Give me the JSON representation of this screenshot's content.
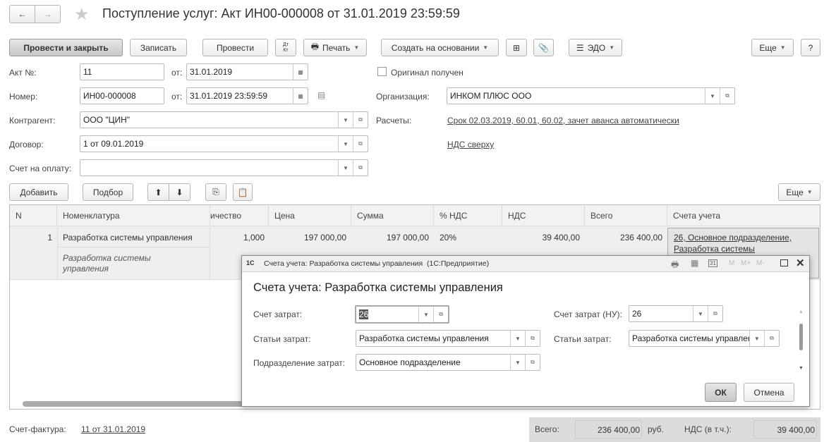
{
  "window": {
    "title": "Поступление услуг: Акт ИН00-000008 от 31.01.2019 23:59:59",
    "back": "←",
    "forward": "→",
    "star": "★"
  },
  "toolbar": {
    "post_close": "Провести и закрыть",
    "save": "Записать",
    "post": "Провести",
    "dtkt_top": "Дт",
    "dtkt_bottom": "Кт",
    "print": "Печать",
    "create_based": "Создать на основании",
    "edo": "ЭДО",
    "more": "Еще",
    "help": "?"
  },
  "form": {
    "act_no_label": "Акт №:",
    "act_no": "11",
    "from_label": "от:",
    "act_date": "31.01.2019",
    "original_label": "Оригинал получен",
    "number_label": "Номер:",
    "number": "ИН00-000008",
    "number_date": "31.01.2019 23:59:59",
    "org_label": "Организация:",
    "org": "ИНКОМ ПЛЮС ООО",
    "counterparty_label": "Контрагент:",
    "counterparty": "ООО \"ЦИН\"",
    "settlements_label": "Расчеты:",
    "settlements_link": "Срок 02.03.2019, 60.01, 60.02, зачет аванса автоматически",
    "contract_label": "Договор:",
    "contract": "1 от 09.01.2019",
    "vat_link": "НДС сверху",
    "invoice_label": "Счет на оплату:",
    "invoice": ""
  },
  "table_toolbar": {
    "add": "Добавить",
    "pick": "Подбор",
    "more": "Еще"
  },
  "table": {
    "columns": [
      "N",
      "Номенклатура",
      "ичество",
      "Цена",
      "Сумма",
      "% НДС",
      "НДС",
      "Всего",
      "Счета учета"
    ],
    "rows": [
      {
        "n": "1",
        "item": "Разработка системы управления",
        "item_sub": "Разработка системы управления",
        "qty": "1,000",
        "price": "197 000,00",
        "sum": "197 000,00",
        "vat_rate": "20%",
        "vat": "39 400,00",
        "total": "236 400,00",
        "accounts": "26, Основное подразделение, Разработка системы"
      }
    ]
  },
  "dialog": {
    "title": "Счета учета: Разработка системы управления  (1С:Предприятие)",
    "logo": "1С",
    "heading": "Счета учета: Разработка системы управления",
    "cost_account_label": "Счет затрат:",
    "cost_account": "26",
    "cost_account_tax_label": "Счет затрат (НУ):",
    "cost_account_tax": "26",
    "cost_items_label": "Статьи затрат:",
    "cost_items": "Разработка системы управления",
    "cost_items_tax_label": "Статьи затрат:",
    "cost_items_tax": "Разработка системы управлени",
    "department_label": "Подразделение затрат:",
    "department": "Основное подразделение",
    "ok": "ОК",
    "cancel": "Отмена",
    "m": "M",
    "mplus": "M+",
    "mminus": "M-",
    "cal": "31"
  },
  "footer": {
    "invoice_label": "Счет-фактура:",
    "invoice_link": "11 от 31.01.2019",
    "total_label": "Всего:",
    "total": "236 400,00",
    "currency": "руб.",
    "vat_label": "НДС (в т.ч.):",
    "vat": "39 400,00"
  }
}
